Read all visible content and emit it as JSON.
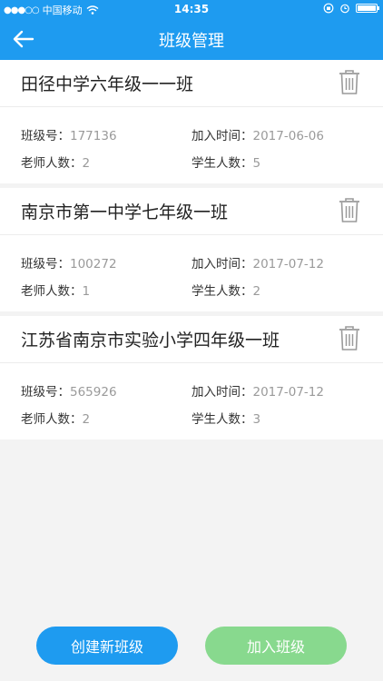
{
  "status_bar": {
    "signal": "●●●○○",
    "carrier": "中国移动",
    "time": "14:35"
  },
  "nav": {
    "title": "班级管理"
  },
  "labels": {
    "class_no": "班级号：",
    "join_time": "加入时间：",
    "teachers": "老师人数：",
    "students": "学生人数："
  },
  "classes": [
    {
      "name": "田径中学六年级一一班",
      "class_no": "177136",
      "join_time": "2017-06-06",
      "teachers": "2",
      "students": "5"
    },
    {
      "name": "南京市第一中学七年级一班",
      "class_no": "100272",
      "join_time": "2017-07-12",
      "teachers": "1",
      "students": "2"
    },
    {
      "name": "江苏省南京市实验小学四年级一班",
      "class_no": "565926",
      "join_time": "2017-07-12",
      "teachers": "2",
      "students": "3"
    }
  ],
  "actions": {
    "create": "创建新班级",
    "join": "加入班级"
  },
  "colors": {
    "primary": "#1e9bf0",
    "join_button": "#88d98e"
  }
}
